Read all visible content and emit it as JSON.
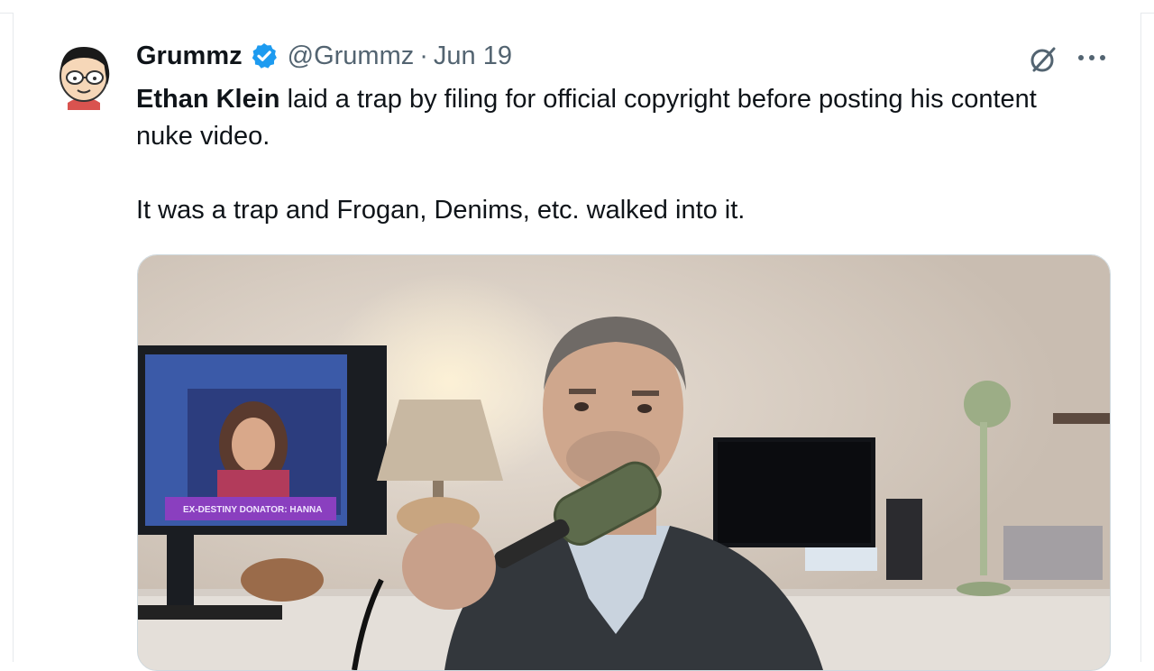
{
  "tweet": {
    "author_name": "Grummz",
    "handle": "@Grummz",
    "separator": "·",
    "date": "Jun 19",
    "mention": "Ethan Klein",
    "text_line1_rest": " laid a trap by filing for official copyright before posting his content nuke video.",
    "text_line2": "It was a trap and Frogan, Denims, etc. walked into it.",
    "media_caption": "EX-DESTINY DONATOR: HANNA"
  },
  "colors": {
    "verified_badge": "#1d9bf0",
    "secondary_text": "#536471",
    "primary_text": "#0f1419"
  },
  "icons": [
    "verified-badge-icon",
    "grok-icon",
    "more-icon"
  ]
}
